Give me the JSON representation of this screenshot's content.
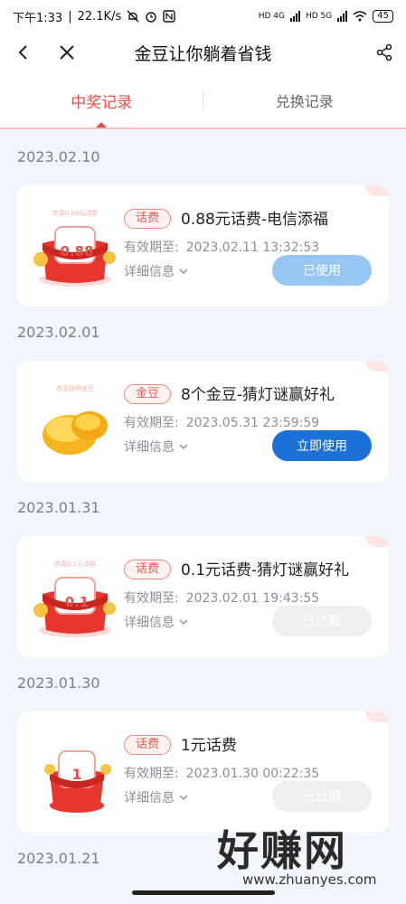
{
  "status_bar": {
    "time": "下午1:33",
    "speed": "22.1K/s",
    "network_1": "HD 4G",
    "network_2": "HD 5G",
    "battery": "45"
  },
  "nav": {
    "title": "金豆让你躺着省钱",
    "back_icon": "back-arrow-icon",
    "close_icon": "close-icon",
    "share_icon": "share-icon"
  },
  "tabs": [
    {
      "label": "中奖记录",
      "active": true
    },
    {
      "label": "兑换记录",
      "active": false
    }
  ],
  "records": [
    {
      "date": "2023.02.10",
      "tag": "话费",
      "title": "0.88元话费-电信添福",
      "expiry_label": "有效期至:",
      "expiry": "2023.02.11 13:32:53",
      "detail_label": "详细信息",
      "button": "已使用",
      "button_state": "used",
      "thumb_caption": "恭喜0.88元话费",
      "thumb_value": "0.88"
    },
    {
      "date": "2023.02.01",
      "tag": "金豆",
      "title": "8个金豆-猜灯谜赢好礼",
      "expiry_label": "有效期至:",
      "expiry": "2023.05.31 23:59:59",
      "detail_label": "详细信息",
      "button": "立即使用",
      "button_state": "active",
      "thumb_caption": "恭喜获得金豆",
      "thumb_value": ""
    },
    {
      "date": "2023.01.31",
      "tag": "话费",
      "title": "0.1元话费-猜灯谜赢好礼",
      "expiry_label": "有效期至:",
      "expiry": "2023.02.01 19:43:55",
      "detail_label": "详细信息",
      "button": "已过期",
      "button_state": "expired",
      "thumb_caption": "恭喜0.1元话费",
      "thumb_value": "0.1"
    },
    {
      "date": "2023.01.30",
      "tag": "话费",
      "title": "1元话费",
      "expiry_label": "有效期至:",
      "expiry": "2023.01.30 00:22:35",
      "detail_label": "详细信息",
      "button": "已过期",
      "button_state": "expired",
      "thumb_caption": "",
      "thumb_value": "1"
    }
  ],
  "next_date": "2023.01.21",
  "watermark": {
    "text": "好赚网",
    "url": "www.zhuanyes.com"
  },
  "colors": {
    "accent": "#e4504a",
    "button_blue": "#1b71d8",
    "button_used": "#97c6f3",
    "background": "#f1f5fc"
  }
}
